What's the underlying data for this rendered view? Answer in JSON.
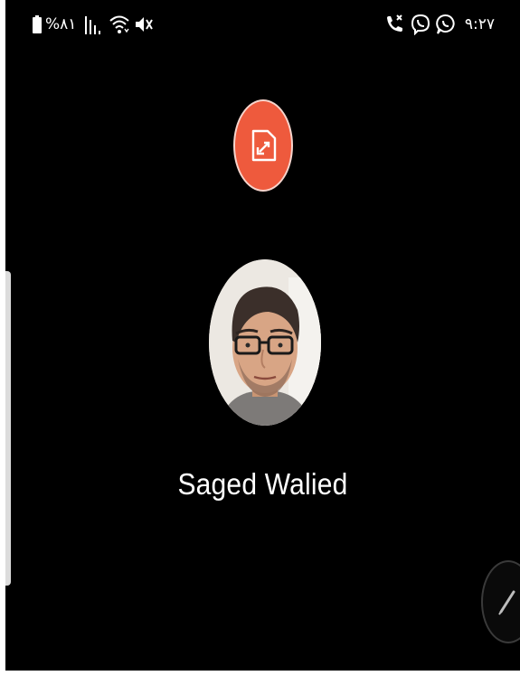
{
  "status_bar": {
    "battery_percent": "%٨١",
    "time": "٩:٢٧",
    "left_icons": [
      "battery-icon",
      "signal-bars-icon",
      "wifi-icon",
      "mute-icon"
    ],
    "right_icons": [
      "missed-call-icon",
      "viber-icon",
      "whatsapp-icon"
    ]
  },
  "call": {
    "caller_name": "Saged Walied",
    "minimize_icon": "minimize-window-icon",
    "edit_icon": "pencil-icon"
  },
  "colors": {
    "background": "#000000",
    "accent": "#ee5a3d",
    "text": "#ffffff"
  }
}
